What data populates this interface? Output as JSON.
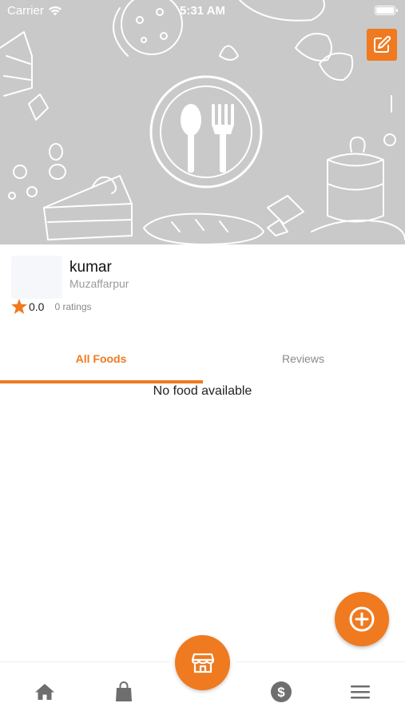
{
  "status_bar": {
    "carrier": "Carrier",
    "time": "5:31 AM"
  },
  "header": {
    "edit_icon": "edit-icon",
    "logo_icon": "spoon-fork-icon"
  },
  "profile": {
    "name": "kumar",
    "city": "Muzaffarpur",
    "rating": "0.0",
    "ratings_count": "0 ratings"
  },
  "tabs": [
    {
      "label": "All Foods",
      "active": true
    },
    {
      "label": "Reviews",
      "active": false
    }
  ],
  "empty_message": "No food available",
  "bottom_nav": {
    "items": [
      "home-icon",
      "shopping-bag-icon",
      "store-icon",
      "dollar-icon",
      "menu-icon"
    ],
    "active": "store-icon"
  },
  "colors": {
    "accent": "#ef7a1f",
    "cover": "#c9c9c9"
  }
}
